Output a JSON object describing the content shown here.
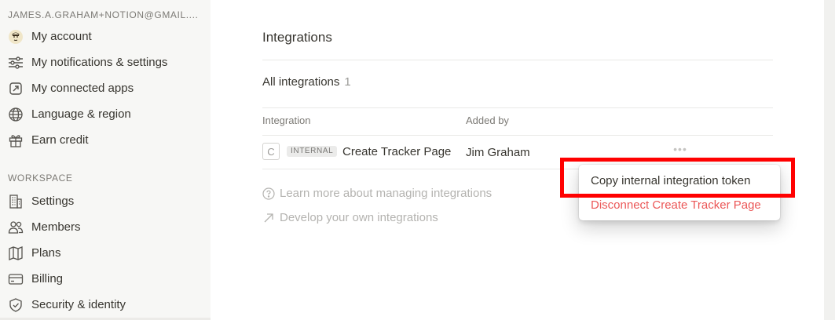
{
  "sidebar": {
    "account_email": "JAMES.A.GRAHAM+NOTION@GMAIL....",
    "account_items": [
      {
        "label": "My account",
        "icon": "avatar-icon"
      },
      {
        "label": "My notifications & settings",
        "icon": "sliders-icon"
      },
      {
        "label": "My connected apps",
        "icon": "external-link-box-icon"
      },
      {
        "label": "Language & region",
        "icon": "globe-icon"
      },
      {
        "label": "Earn credit",
        "icon": "gift-icon"
      }
    ],
    "workspace_label": "WORKSPACE",
    "workspace_items": [
      {
        "label": "Settings",
        "icon": "building-icon"
      },
      {
        "label": "Members",
        "icon": "people-icon"
      },
      {
        "label": "Plans",
        "icon": "map-icon"
      },
      {
        "label": "Billing",
        "icon": "credit-card-icon"
      },
      {
        "label": "Security & identity",
        "icon": "shield-icon"
      }
    ]
  },
  "main": {
    "title": "Integrations",
    "section_title": "All integrations",
    "section_count": "1",
    "columns": [
      "Integration",
      "Added by"
    ],
    "integration": {
      "icon_letter": "C",
      "badge": "INTERNAL",
      "name": "Create Tracker Page",
      "added_by": "Jim Graham",
      "more_label": "•••"
    },
    "links": [
      {
        "label": "Learn more about managing integrations",
        "icon": "help-circle-icon"
      },
      {
        "label": "Develop your own integrations",
        "icon": "arrow-up-right-icon"
      }
    ]
  },
  "menu": {
    "copy_token": "Copy internal integration token",
    "disconnect": "Disconnect Create Tracker Page"
  },
  "colors": {
    "danger": "#eb5757",
    "highlight": "#ff0000",
    "sidebar_bg": "#f7f7f5"
  }
}
